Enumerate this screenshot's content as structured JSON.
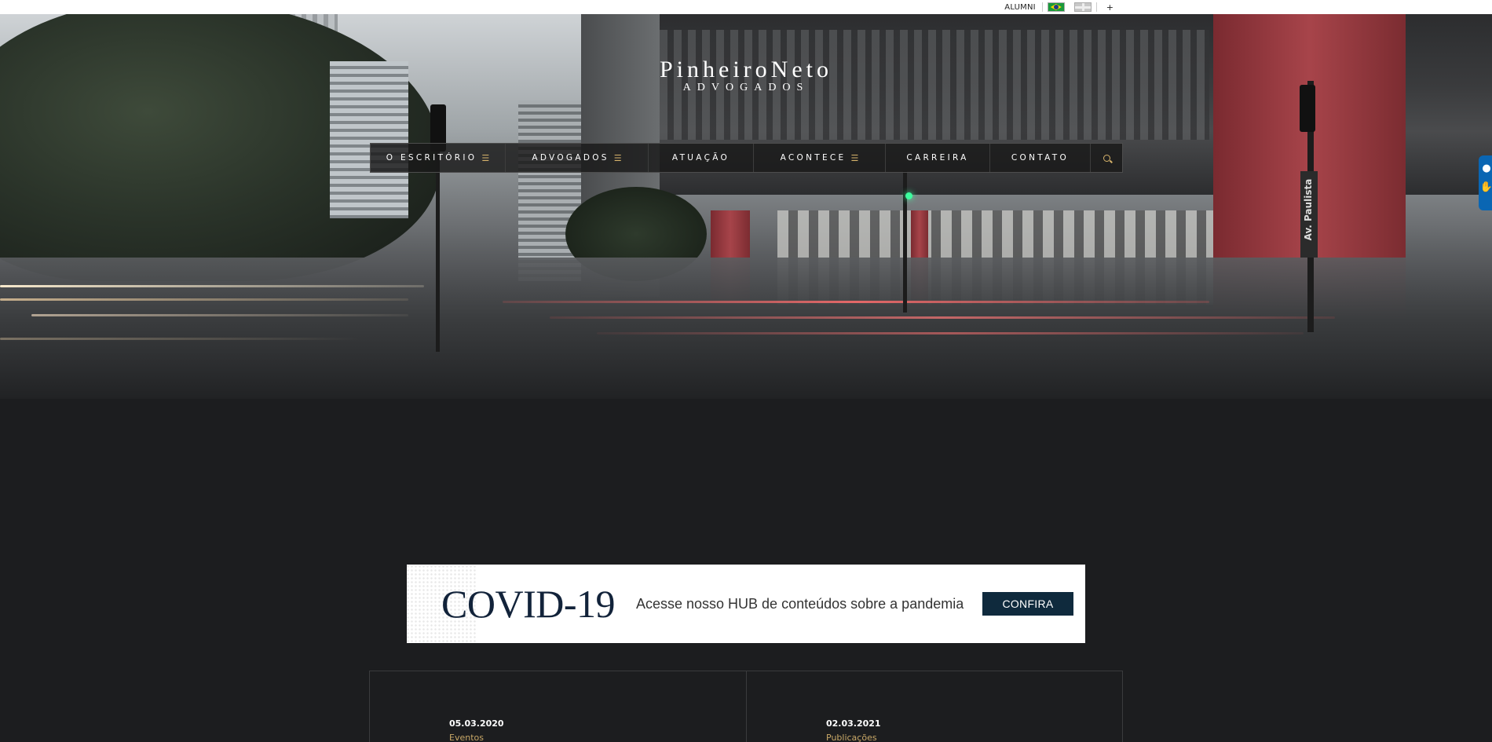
{
  "topbar": {
    "alumni_label": "ALUMNI",
    "languages": [
      {
        "icon": "brazil-flag-icon"
      },
      {
        "icon": "uk-flag-icon"
      }
    ],
    "plus_label": "+"
  },
  "logo": {
    "main": "PinheiroNeto",
    "sub": "ADVOGADOS"
  },
  "nav": {
    "items": [
      {
        "label": "O ESCRITÓRIO",
        "has_menu": true
      },
      {
        "label": "ADVOGADOS",
        "has_menu": true
      },
      {
        "label": "ATUAÇÃO",
        "has_menu": false
      },
      {
        "label": "ACONTECE",
        "has_menu": true
      },
      {
        "label": "CARREIRA",
        "has_menu": false
      },
      {
        "label": "CONTATO",
        "has_menu": false
      }
    ],
    "menu_glyph": "☰",
    "search_icon": "search-icon",
    "accent_color": "#d7b36b"
  },
  "hero": {
    "street_sign": "Av. Paulista"
  },
  "covid_banner": {
    "title": "COVID-19",
    "text": "Acesse nosso HUB de conteúdos sobre a pandemia",
    "button_label": "CONFIRA",
    "button_color": "#0f2a3d"
  },
  "news": [
    {
      "date": "05.03.2020",
      "category": "Eventos"
    },
    {
      "date": "02.03.2021",
      "category": "Publicações"
    }
  ],
  "colors": {
    "background": "#1c1d1f",
    "category_gold": "#c9a867"
  }
}
